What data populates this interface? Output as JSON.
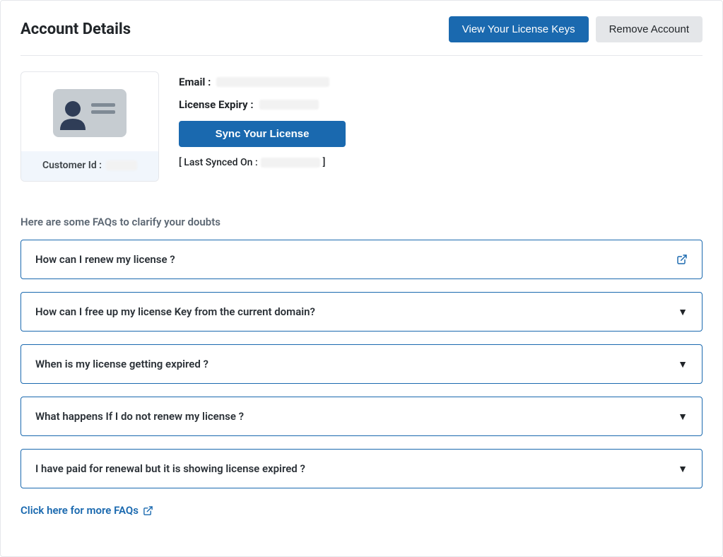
{
  "header": {
    "title": "Account Details",
    "view_keys_label": "View Your License Keys",
    "remove_account_label": "Remove Account"
  },
  "account": {
    "customer_id_label": "Customer Id :",
    "customer_id_value": "",
    "email_label": "Email :",
    "email_value": "",
    "license_expiry_label": "License Expiry :",
    "license_expiry_value": "",
    "sync_button_label": "Sync Your License",
    "last_synced_prefix": "[ Last Synced On :",
    "last_synced_value": "",
    "last_synced_suffix": "]"
  },
  "faq": {
    "intro": "Here are some FAQs to clarify your doubts",
    "items": [
      {
        "question": "How can I renew my license ?",
        "icon": "external"
      },
      {
        "question": "How can I free up my license Key from the current domain?",
        "icon": "caret"
      },
      {
        "question": "When is my license getting expired ?",
        "icon": "caret"
      },
      {
        "question": "What happens If I do not renew my license ?",
        "icon": "caret"
      },
      {
        "question": "I have paid for renewal but it is showing license expired ?",
        "icon": "caret"
      }
    ],
    "more_link_label": "Click here for more FAQs"
  }
}
